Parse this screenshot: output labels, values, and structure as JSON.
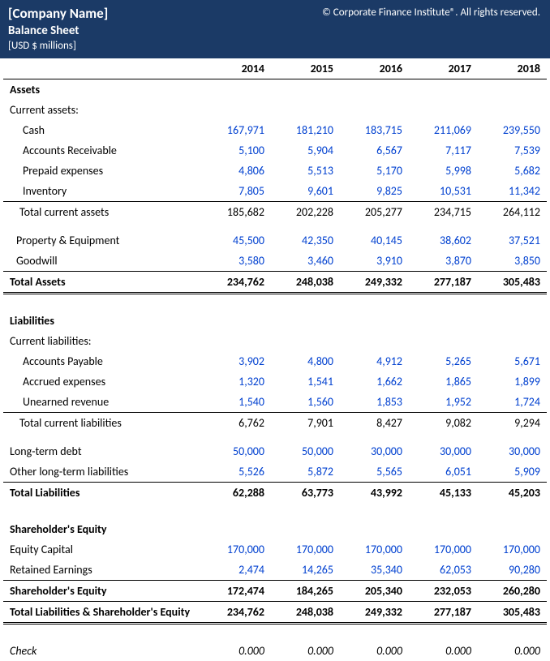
{
  "header": {
    "company": "[Company Name]",
    "copyright": "© Corporate Finance Institute®. All rights reserved.",
    "title": "Balance Sheet",
    "subtitle": "[USD $ millions]"
  },
  "years": [
    "2014",
    "2015",
    "2016",
    "2017",
    "2018"
  ],
  "assets": {
    "heading": "Assets",
    "current_heading": "Current assets:",
    "cash": {
      "label": "Cash",
      "vals": [
        "167,971",
        "181,210",
        "183,715",
        "211,069",
        "239,550"
      ]
    },
    "ar": {
      "label": "Accounts Receivable",
      "vals": [
        "5,100",
        "5,904",
        "6,567",
        "7,117",
        "7,539"
      ]
    },
    "prepaid": {
      "label": "Prepaid expenses",
      "vals": [
        "4,806",
        "5,513",
        "5,170",
        "5,998",
        "5,682"
      ]
    },
    "inventory": {
      "label": "Inventory",
      "vals": [
        "7,805",
        "9,601",
        "9,825",
        "10,531",
        "11,342"
      ]
    },
    "total_current": {
      "label": "Total current assets",
      "vals": [
        "185,682",
        "202,228",
        "205,277",
        "234,715",
        "264,112"
      ]
    },
    "ppe": {
      "label": "Property & Equipment",
      "vals": [
        "45,500",
        "42,350",
        "40,145",
        "38,602",
        "37,521"
      ]
    },
    "goodwill": {
      "label": "Goodwill",
      "vals": [
        "3,580",
        "3,460",
        "3,910",
        "3,870",
        "3,850"
      ]
    },
    "total": {
      "label": "Total Assets",
      "vals": [
        "234,762",
        "248,038",
        "249,332",
        "277,187",
        "305,483"
      ]
    }
  },
  "liabilities": {
    "heading": "Liabilities",
    "current_heading": "Current liabilities:",
    "ap": {
      "label": "Accounts Payable",
      "vals": [
        "3,902",
        "4,800",
        "4,912",
        "5,265",
        "5,671"
      ]
    },
    "accrued": {
      "label": "Accrued expenses",
      "vals": [
        "1,320",
        "1,541",
        "1,662",
        "1,865",
        "1,899"
      ]
    },
    "unearned": {
      "label": "Unearned revenue",
      "vals": [
        "1,540",
        "1,560",
        "1,853",
        "1,952",
        "1,724"
      ]
    },
    "total_current": {
      "label": "Total current liabilities",
      "vals": [
        "6,762",
        "7,901",
        "8,427",
        "9,082",
        "9,294"
      ]
    },
    "ltd": {
      "label": "Long-term debt",
      "vals": [
        "50,000",
        "50,000",
        "30,000",
        "30,000",
        "30,000"
      ]
    },
    "other_lt": {
      "label": "Other long-term liabilities",
      "vals": [
        "5,526",
        "5,872",
        "5,565",
        "6,051",
        "5,909"
      ]
    },
    "total": {
      "label": "Total Liabilities",
      "vals": [
        "62,288",
        "63,773",
        "43,992",
        "45,133",
        "45,203"
      ]
    }
  },
  "equity": {
    "heading": "Shareholder's Equity",
    "capital": {
      "label": "Equity Capital",
      "vals": [
        "170,000",
        "170,000",
        "170,000",
        "170,000",
        "170,000"
      ]
    },
    "retained": {
      "label": "Retained Earnings",
      "vals": [
        "2,474",
        "14,265",
        "35,340",
        "62,053",
        "90,280"
      ]
    },
    "total": {
      "label": "Shareholder's Equity",
      "vals": [
        "172,474",
        "184,265",
        "205,340",
        "232,053",
        "260,280"
      ]
    },
    "total_lse": {
      "label": "Total Liabilities & Shareholder's Equity",
      "vals": [
        "234,762",
        "248,038",
        "249,332",
        "277,187",
        "305,483"
      ]
    }
  },
  "check": {
    "label": "Check",
    "vals": [
      "0.000",
      "0.000",
      "0.000",
      "0.000",
      "0.000"
    ]
  }
}
